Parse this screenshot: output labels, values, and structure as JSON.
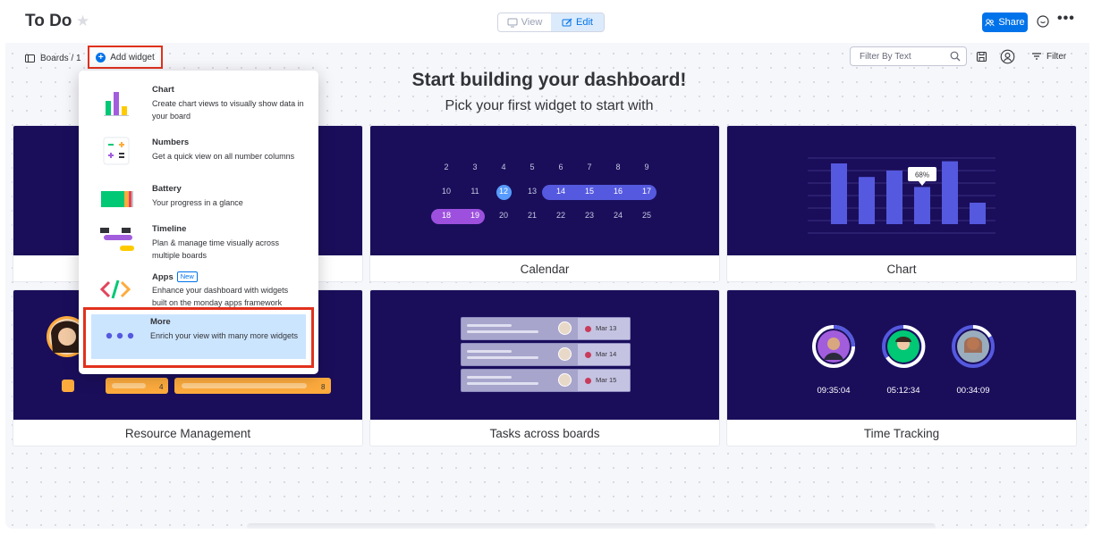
{
  "header": {
    "title": "To Do",
    "view_label": "View",
    "edit_label": "Edit",
    "share_label": "Share",
    "more_label": "•••"
  },
  "subbar": {
    "breadcrumb": "Boards / 1",
    "add_widget_label": "Add widget",
    "filter_placeholder": "Filter By Text",
    "filter_label": "Filter"
  },
  "main": {
    "heading": "Start building your dashboard!",
    "subheading": "Pick your first widget to start with"
  },
  "dropdown": {
    "items": [
      {
        "title": "Chart",
        "desc": "Create chart views to visually show data in your board"
      },
      {
        "title": "Numbers",
        "desc": "Get a quick view on all number columns"
      },
      {
        "title": "Battery",
        "desc": "Your progress in a glance"
      },
      {
        "title": "Timeline",
        "desc": "Plan & manage time visually across multiple boards"
      },
      {
        "title": "Apps",
        "badge": "New",
        "desc": "Enhance your dashboard with widgets built on the monday apps framework"
      },
      {
        "title": "More",
        "desc": "Enrich your view with many more widgets"
      }
    ]
  },
  "cards": {
    "calendar": {
      "label": "Calendar",
      "rows": [
        [
          "2",
          "3",
          "4",
          "5",
          "6",
          "7",
          "8",
          "9"
        ],
        [
          "10",
          "11",
          "12",
          "13",
          "14",
          "15",
          "16",
          "17"
        ],
        [
          "18",
          "19",
          "20",
          "21",
          "22",
          "23",
          "24",
          "25"
        ]
      ]
    },
    "chart": {
      "label": "Chart",
      "tooltip": "68%",
      "bars": [
        0.85,
        0.66,
        0.75,
        0.52,
        0.88,
        0.3
      ]
    },
    "resource": {
      "label": "Resource Management",
      "count_a": "4",
      "count_b": "8"
    },
    "tasks": {
      "label": "Tasks across boards",
      "dates": [
        "Mar 13",
        "Mar 14",
        "Mar 15"
      ]
    },
    "time": {
      "label": "Time Tracking",
      "times": [
        "09:35:04",
        "05:12:34",
        "00:34:09"
      ]
    }
  },
  "colors": {
    "primary": "#0073ea",
    "highlight": "#e2311d",
    "card_art_bg": "#1a0e5b",
    "calendar_pill": "#5559df",
    "calendar_pill_alt": "#9d50dd",
    "chart_bar": "#5559df",
    "resource_bar": "#fdab3d",
    "battery_green": "#00c875",
    "battery_orange": "#fdab3d"
  }
}
